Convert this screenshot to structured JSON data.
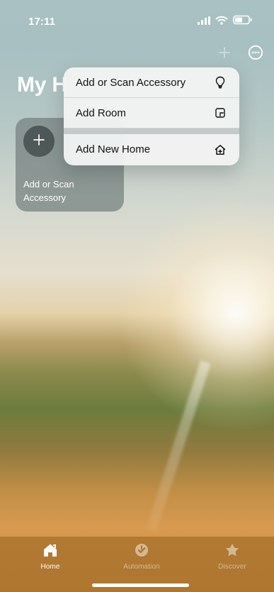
{
  "status_bar": {
    "time": "17:11",
    "signal_icon": "cellular-bars-icon",
    "wifi_icon": "wifi-icon",
    "battery_icon": "battery-icon"
  },
  "header": {
    "title_visible": "My H",
    "add_icon": "plus-icon",
    "more_icon": "ellipsis-circle-icon"
  },
  "tile": {
    "label": "Add or Scan Accessory",
    "icon": "plus-icon"
  },
  "menu": {
    "items": [
      {
        "label": "Add or Scan Accessory",
        "icon": "lightbulb-icon"
      },
      {
        "label": "Add Room",
        "icon": "room-icon"
      },
      {
        "label": "Add New Home",
        "icon": "home-plus-icon"
      }
    ]
  },
  "tabbar": {
    "items": [
      {
        "label": "Home",
        "icon": "house-icon"
      },
      {
        "label": "Automation",
        "icon": "clock-check-icon"
      },
      {
        "label": "Discover",
        "icon": "star-icon"
      }
    ]
  }
}
